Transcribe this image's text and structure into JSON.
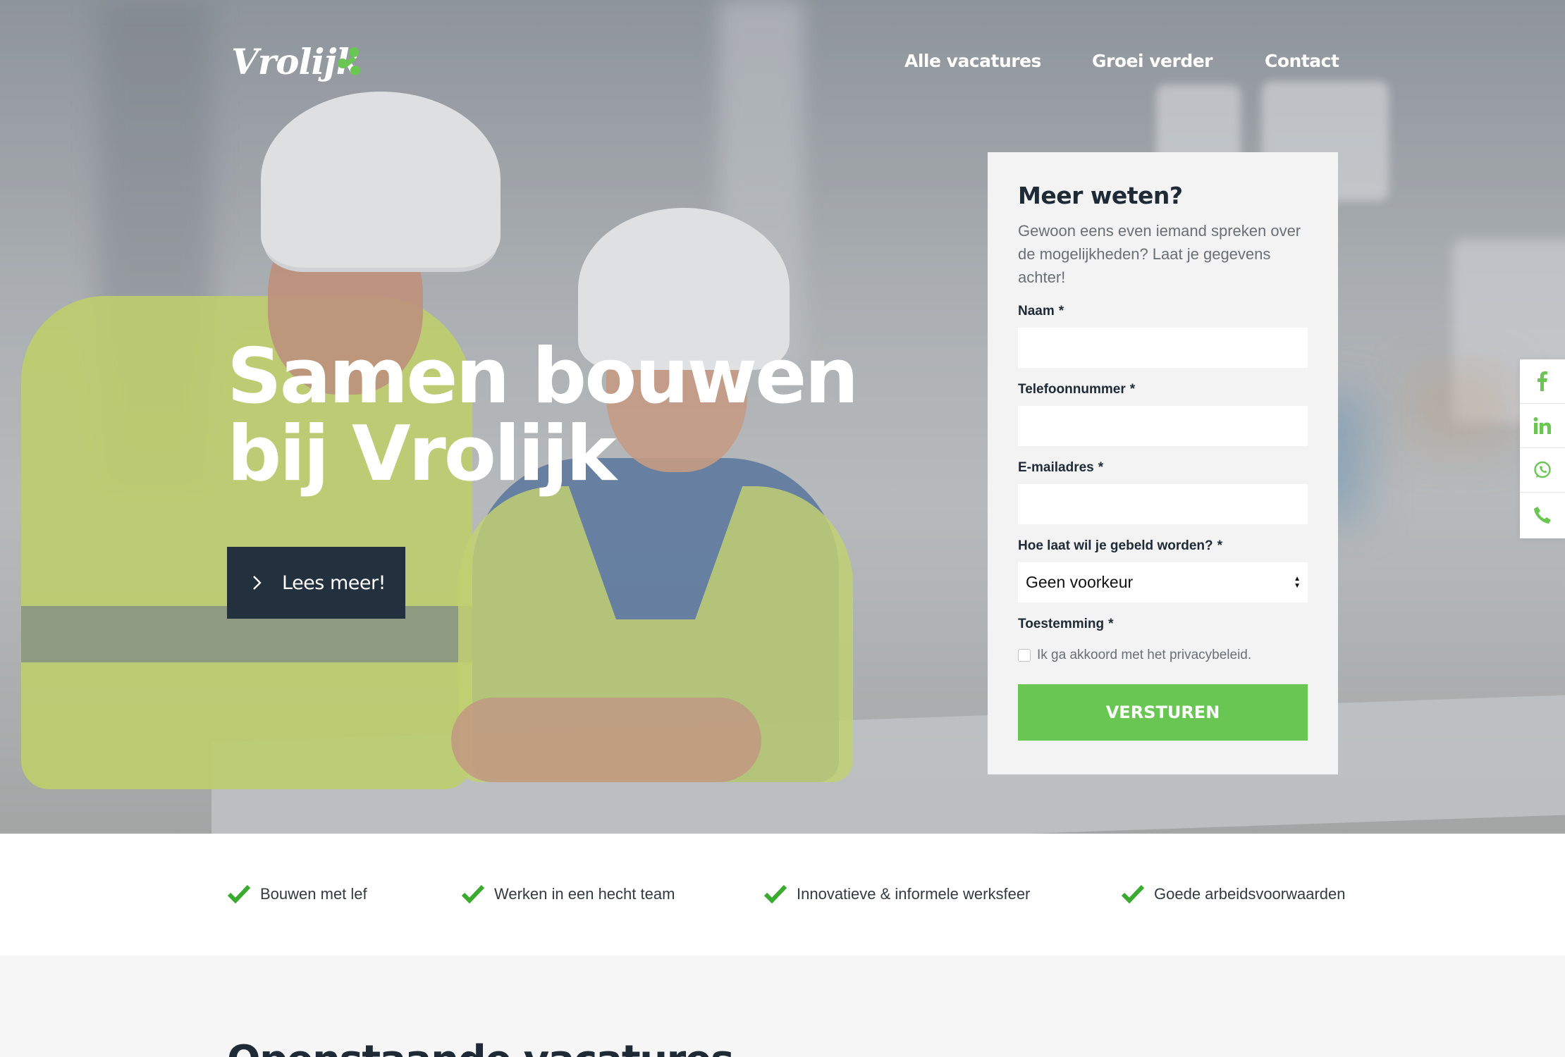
{
  "brand": {
    "logo_text": "Vrolijk",
    "accent_color": "#6ac653",
    "dark_color": "#23303d"
  },
  "nav": {
    "items": [
      "Alle vacatures",
      "Groei verder",
      "Contact"
    ]
  },
  "hero": {
    "title_line1": "Samen bouwen",
    "title_line2": "bij Vrolijk",
    "cta_label": "Lees meer!",
    "cta_icon": "chevron-right-icon"
  },
  "form": {
    "title": "Meer weten?",
    "intro": "Gewoon eens even iemand spreken over de mogelijkheden? Laat je gegevens achter!",
    "required_marker": "*",
    "fields": {
      "name_label": "Naam",
      "phone_label": "Telefoonnummer",
      "email_label": "E-mailadres",
      "time_label": "Hoe laat wil je gebeld worden?",
      "time_value": "Geen voorkeur",
      "consent_label": "Toestemming",
      "consent_text": "Ik ga akkoord met het privacybeleid.",
      "consent_checked": false
    },
    "submit_label": "VERSTUREN"
  },
  "social": {
    "icons": [
      "facebook-icon",
      "linkedin-icon",
      "whatsapp-icon",
      "phone-icon"
    ]
  },
  "usps": [
    "Bouwen met lef",
    "Werken in een hecht team",
    "Innovatieve & informele werksfeer",
    "Goede arbeidsvoorwaarden"
  ],
  "vacancies": {
    "title": "Openstaande vacatures"
  }
}
